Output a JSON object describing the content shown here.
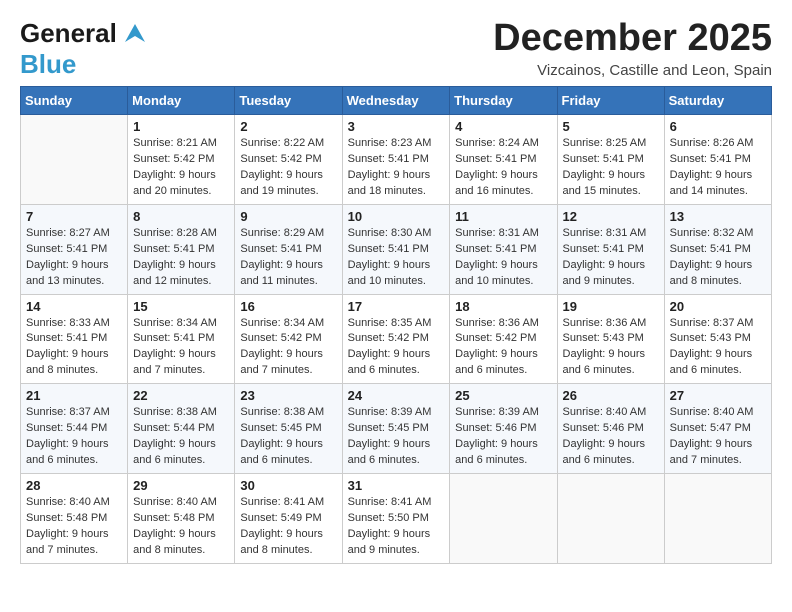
{
  "logo": {
    "line1": "General",
    "line2": "Blue"
  },
  "header": {
    "title": "December 2025",
    "subtitle": "Vizcainos, Castille and Leon, Spain"
  },
  "columns": [
    "Sunday",
    "Monday",
    "Tuesday",
    "Wednesday",
    "Thursday",
    "Friday",
    "Saturday"
  ],
  "weeks": [
    [
      {
        "day": "",
        "info": ""
      },
      {
        "day": "1",
        "info": "Sunrise: 8:21 AM\nSunset: 5:42 PM\nDaylight: 9 hours\nand 20 minutes."
      },
      {
        "day": "2",
        "info": "Sunrise: 8:22 AM\nSunset: 5:42 PM\nDaylight: 9 hours\nand 19 minutes."
      },
      {
        "day": "3",
        "info": "Sunrise: 8:23 AM\nSunset: 5:41 PM\nDaylight: 9 hours\nand 18 minutes."
      },
      {
        "day": "4",
        "info": "Sunrise: 8:24 AM\nSunset: 5:41 PM\nDaylight: 9 hours\nand 16 minutes."
      },
      {
        "day": "5",
        "info": "Sunrise: 8:25 AM\nSunset: 5:41 PM\nDaylight: 9 hours\nand 15 minutes."
      },
      {
        "day": "6",
        "info": "Sunrise: 8:26 AM\nSunset: 5:41 PM\nDaylight: 9 hours\nand 14 minutes."
      }
    ],
    [
      {
        "day": "7",
        "info": "Sunrise: 8:27 AM\nSunset: 5:41 PM\nDaylight: 9 hours\nand 13 minutes."
      },
      {
        "day": "8",
        "info": "Sunrise: 8:28 AM\nSunset: 5:41 PM\nDaylight: 9 hours\nand 12 minutes."
      },
      {
        "day": "9",
        "info": "Sunrise: 8:29 AM\nSunset: 5:41 PM\nDaylight: 9 hours\nand 11 minutes."
      },
      {
        "day": "10",
        "info": "Sunrise: 8:30 AM\nSunset: 5:41 PM\nDaylight: 9 hours\nand 10 minutes."
      },
      {
        "day": "11",
        "info": "Sunrise: 8:31 AM\nSunset: 5:41 PM\nDaylight: 9 hours\nand 10 minutes."
      },
      {
        "day": "12",
        "info": "Sunrise: 8:31 AM\nSunset: 5:41 PM\nDaylight: 9 hours\nand 9 minutes."
      },
      {
        "day": "13",
        "info": "Sunrise: 8:32 AM\nSunset: 5:41 PM\nDaylight: 9 hours\nand 8 minutes."
      }
    ],
    [
      {
        "day": "14",
        "info": "Sunrise: 8:33 AM\nSunset: 5:41 PM\nDaylight: 9 hours\nand 8 minutes."
      },
      {
        "day": "15",
        "info": "Sunrise: 8:34 AM\nSunset: 5:41 PM\nDaylight: 9 hours\nand 7 minutes."
      },
      {
        "day": "16",
        "info": "Sunrise: 8:34 AM\nSunset: 5:42 PM\nDaylight: 9 hours\nand 7 minutes."
      },
      {
        "day": "17",
        "info": "Sunrise: 8:35 AM\nSunset: 5:42 PM\nDaylight: 9 hours\nand 6 minutes."
      },
      {
        "day": "18",
        "info": "Sunrise: 8:36 AM\nSunset: 5:42 PM\nDaylight: 9 hours\nand 6 minutes."
      },
      {
        "day": "19",
        "info": "Sunrise: 8:36 AM\nSunset: 5:43 PM\nDaylight: 9 hours\nand 6 minutes."
      },
      {
        "day": "20",
        "info": "Sunrise: 8:37 AM\nSunset: 5:43 PM\nDaylight: 9 hours\nand 6 minutes."
      }
    ],
    [
      {
        "day": "21",
        "info": "Sunrise: 8:37 AM\nSunset: 5:44 PM\nDaylight: 9 hours\nand 6 minutes."
      },
      {
        "day": "22",
        "info": "Sunrise: 8:38 AM\nSunset: 5:44 PM\nDaylight: 9 hours\nand 6 minutes."
      },
      {
        "day": "23",
        "info": "Sunrise: 8:38 AM\nSunset: 5:45 PM\nDaylight: 9 hours\nand 6 minutes."
      },
      {
        "day": "24",
        "info": "Sunrise: 8:39 AM\nSunset: 5:45 PM\nDaylight: 9 hours\nand 6 minutes."
      },
      {
        "day": "25",
        "info": "Sunrise: 8:39 AM\nSunset: 5:46 PM\nDaylight: 9 hours\nand 6 minutes."
      },
      {
        "day": "26",
        "info": "Sunrise: 8:40 AM\nSunset: 5:46 PM\nDaylight: 9 hours\nand 6 minutes."
      },
      {
        "day": "27",
        "info": "Sunrise: 8:40 AM\nSunset: 5:47 PM\nDaylight: 9 hours\nand 7 minutes."
      }
    ],
    [
      {
        "day": "28",
        "info": "Sunrise: 8:40 AM\nSunset: 5:48 PM\nDaylight: 9 hours\nand 7 minutes."
      },
      {
        "day": "29",
        "info": "Sunrise: 8:40 AM\nSunset: 5:48 PM\nDaylight: 9 hours\nand 8 minutes."
      },
      {
        "day": "30",
        "info": "Sunrise: 8:41 AM\nSunset: 5:49 PM\nDaylight: 9 hours\nand 8 minutes."
      },
      {
        "day": "31",
        "info": "Sunrise: 8:41 AM\nSunset: 5:50 PM\nDaylight: 9 hours\nand 9 minutes."
      },
      {
        "day": "",
        "info": ""
      },
      {
        "day": "",
        "info": ""
      },
      {
        "day": "",
        "info": ""
      }
    ]
  ]
}
